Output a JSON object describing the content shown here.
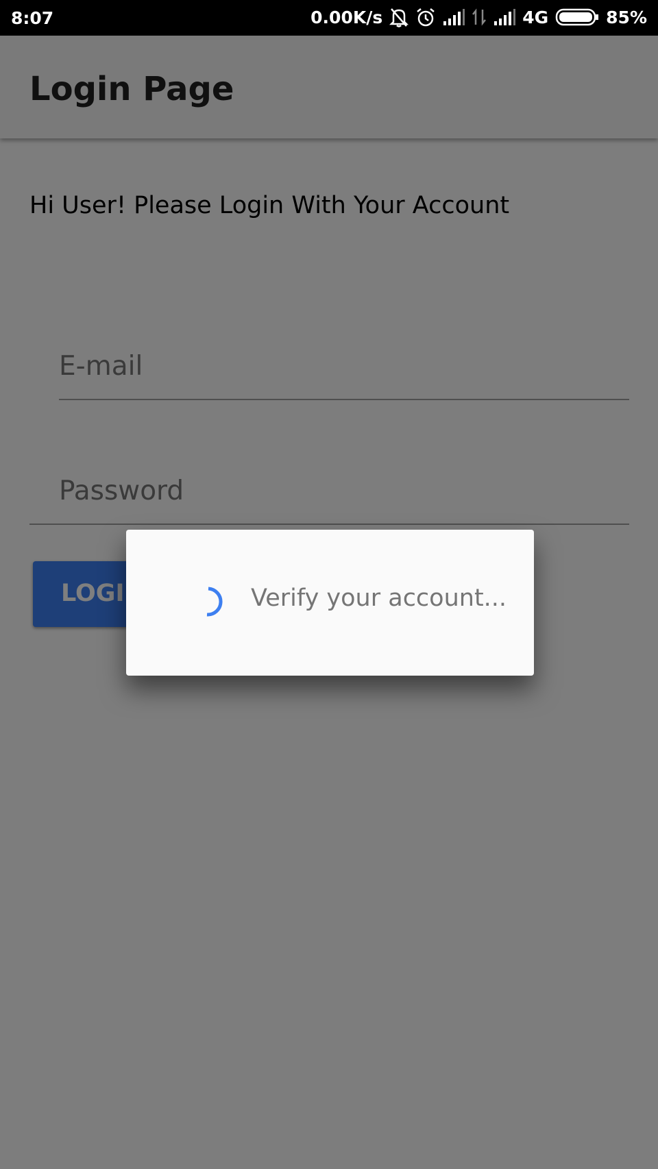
{
  "status_bar": {
    "time": "8:07",
    "network_speed": "0.00K/s",
    "network_type": "4G",
    "battery": "85%",
    "icons": [
      "bell-off-icon",
      "alarm-icon",
      "signal-icon",
      "data-arrows-icon",
      "signal-icon",
      "battery-icon"
    ]
  },
  "app_bar": {
    "title": "Login Page"
  },
  "main": {
    "greeting": "Hi User! Please Login With Your Account",
    "email_label": "E-mail",
    "password_label": "Password",
    "login_label": "LOGIN"
  },
  "dialog": {
    "message": "Verify your account...",
    "spinner_color": "#3d7ff0"
  },
  "colors": {
    "accent": "#3d7ff0",
    "scrim": "rgba(0,0,0,0.5)"
  }
}
